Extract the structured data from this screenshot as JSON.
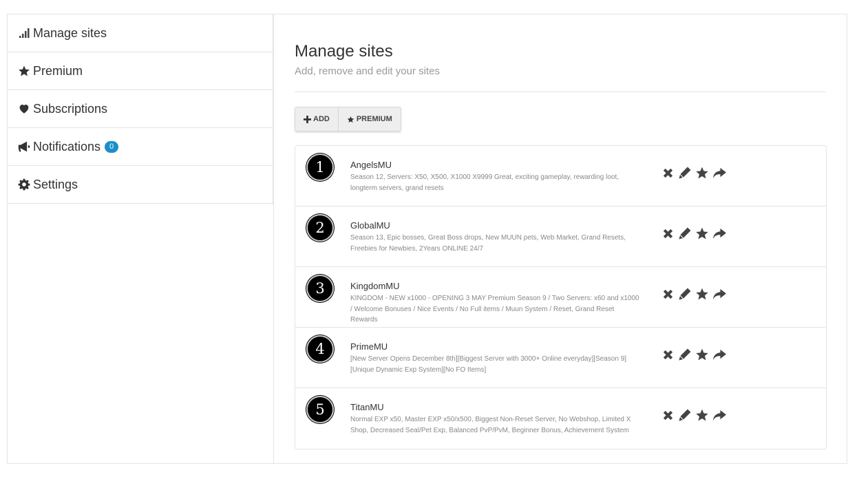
{
  "sidebar": {
    "items": [
      {
        "label": "Manage sites",
        "icon": "signal-bars-icon"
      },
      {
        "label": "Premium",
        "icon": "star-icon"
      },
      {
        "label": "Subscriptions",
        "icon": "heart-icon"
      },
      {
        "label": "Notifications",
        "icon": "megaphone-icon",
        "badge": "0"
      },
      {
        "label": "Settings",
        "icon": "gear-icon"
      }
    ]
  },
  "main": {
    "title": "Manage sites",
    "subtitle": "Add, remove and edit your sites",
    "toolbar": {
      "add_label": "ADD",
      "premium_label": "PREMIUM"
    },
    "sites": [
      {
        "rank": "1",
        "name": "AngelsMU",
        "description": "Season 12, Servers: X50, X500, X1000 X9999 Great, exciting gameplay, rewarding loot, longterm servers, grand resets"
      },
      {
        "rank": "2",
        "name": "GlobalMU",
        "description": "Season 13, Epic bosses, Great Boss drops, New MUUN pets, Web Market, Grand Resets, Freebies for Newbies, 2Years ONLINE 24/7"
      },
      {
        "rank": "3",
        "name": "KingdomMU",
        "description": "KINGDOM - NEW x1000 - OPENING 3 MAY Premium Season 9 / Two Servers: x60 and x1000 / Welcome Bonuses / Nice Events / No Full items / Muun System / Reset, Grand Reset Rewards"
      },
      {
        "rank": "4",
        "name": "PrimeMU",
        "description": "[New Server Opens December 8th][Biggest Server with 3000+ Online everyday][Season 9][Unique Dynamic Exp System][No FO Items]"
      },
      {
        "rank": "5",
        "name": "TitanMU",
        "description": "Normal EXP x50, Master EXP x50/x500, Biggest Non-Reset Server, No Webshop, Limited X Shop, Decreased Seal/Pet Exp, Balanced PvP/PvM, Beginner Bonus, Achievement System"
      }
    ],
    "row_actions": [
      "remove-icon",
      "edit-icon",
      "star-icon",
      "share-icon"
    ]
  },
  "colors": {
    "badge": "#1a8fc9",
    "icon": "#444444",
    "rank_bg": "#000000"
  }
}
